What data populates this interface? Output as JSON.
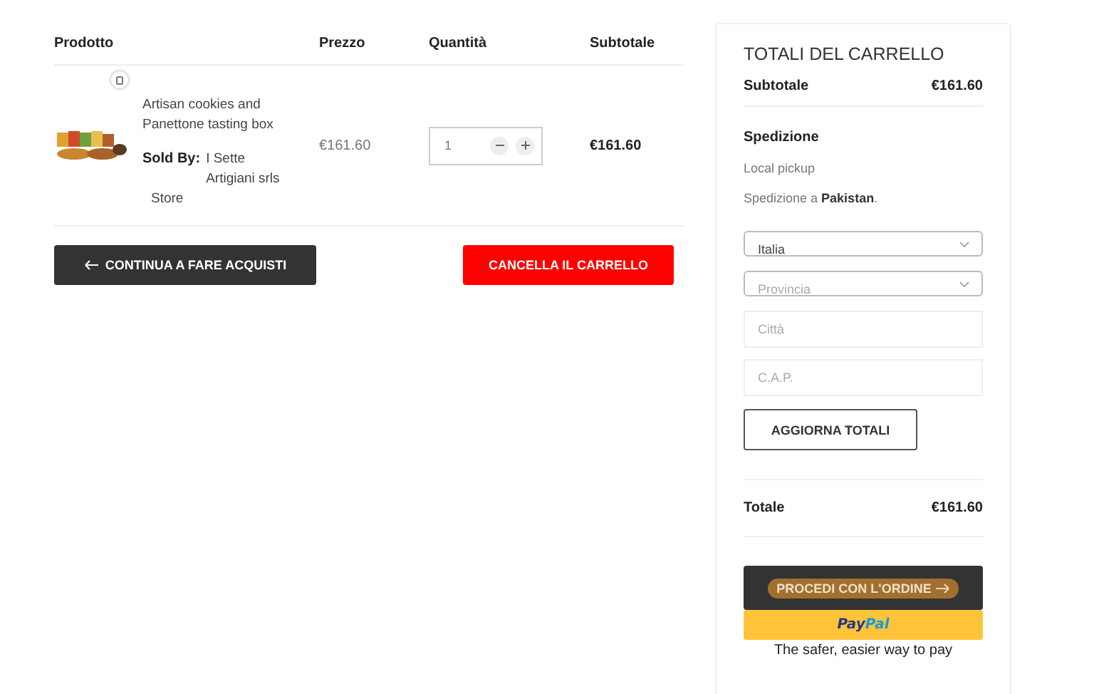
{
  "cart_table": {
    "columns": [
      "Prodotto",
      "Prezzo",
      "Quantità",
      "Subtotale"
    ],
    "rows": [
      {
        "name": "Artisan cookies and Panettone tasting box",
        "sold_by_label": "Sold By:",
        "vendor": "I Sette Artigiani srls",
        "vendor_suffix": "Store",
        "price": "€161.60",
        "quantity": "1",
        "subtotal": "€161.60"
      }
    ]
  },
  "actions": [
    {
      "kind": "back",
      "label": "CONTINUA A FARE ACQUISTI"
    },
    {
      "kind": "danger",
      "label": "CANCELLA IL CARRELLO"
    }
  ],
  "totals": {
    "title": "TOTALI DEL CARRELLO",
    "subtotal_label": "Subtotale",
    "subtotal": "€161.60",
    "shipping_label": "Spedizione",
    "shipping_method": "Local pickup",
    "shipping_to": "Spedizione a **Pakistan**.",
    "fields": [
      {
        "kind": "select",
        "value": "Italia",
        "placeholder_style": false
      },
      {
        "kind": "select",
        "value": "Provincia",
        "placeholder_style": true
      },
      {
        "kind": "input",
        "placeholder": "Città"
      },
      {
        "kind": "input",
        "placeholder": "C.A.P."
      }
    ],
    "update_button": "AGGIORNA TOTALI",
    "total_label": "Totale",
    "total": "€161.60",
    "checkout_button": "PROCEDI CON L'ORDINE",
    "paypal": [
      "Pay",
      "Pal"
    ],
    "paypal_tagline": "The safer, easier way to pay"
  }
}
